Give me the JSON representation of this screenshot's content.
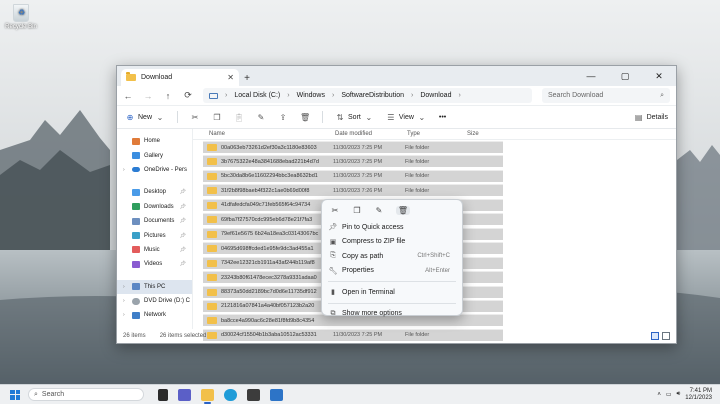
{
  "desktop": {
    "recycle_bin_label": "Recycle Bin"
  },
  "window": {
    "tab_title": "Download",
    "close_tab_glyph": "✕",
    "new_tab_glyph": "+",
    "controls": {
      "minimize": "—",
      "maximize": "▢",
      "close": "✕"
    },
    "breadcrumbs": [
      "Local Disk (C:)",
      "Windows",
      "SoftwareDistribution",
      "Download"
    ],
    "search_placeholder": "Search Download"
  },
  "toolbar": {
    "new_label": "New",
    "sort_label": "Sort",
    "view_label": "View",
    "more_label": "•••",
    "details_label": "Details"
  },
  "sidebar": {
    "items": [
      {
        "label": "Home",
        "icon": "home-icon"
      },
      {
        "label": "Gallery",
        "icon": "gallery-icon"
      },
      {
        "label": "OneDrive - Pers",
        "icon": "onedrive-icon"
      },
      {
        "label": "Desktop",
        "icon": "desktop-icon",
        "pinned": true
      },
      {
        "label": "Downloads",
        "icon": "downloads-icon",
        "pinned": true
      },
      {
        "label": "Documents",
        "icon": "documents-icon",
        "pinned": true
      },
      {
        "label": "Pictures",
        "icon": "pictures-icon",
        "pinned": true
      },
      {
        "label": "Music",
        "icon": "music-icon",
        "pinned": true
      },
      {
        "label": "Videos",
        "icon": "videos-icon",
        "pinned": true
      },
      {
        "label": "This PC",
        "icon": "this-pc-icon",
        "selected": true
      },
      {
        "label": "DVD Drive (D:) C",
        "icon": "dvd-icon"
      },
      {
        "label": "Network",
        "icon": "network-icon"
      }
    ]
  },
  "columns": {
    "name": "Name",
    "date": "Date modified",
    "type": "Type",
    "size": "Size"
  },
  "files": [
    {
      "name": "00a063eb73261d2ef30a3c1180e83603",
      "date": "11/30/2023 7:25 PM",
      "type": "File folder"
    },
    {
      "name": "3b7675322e48a3841688ebad221b4d7d",
      "date": "11/30/2023 7:25 PM",
      "type": "File folder"
    },
    {
      "name": "5bc30da8b6e11602294bbc3ea8632bd1",
      "date": "11/30/2023 7:25 PM",
      "type": "File folder"
    },
    {
      "name": "31f2b8f98baeb4f322c1ae0b69d00f8",
      "date": "11/30/2023 7:26 PM",
      "type": "File folder"
    },
    {
      "name": "41dfafedcfa049c71feb565f64c94734",
      "date": "",
      "type": ""
    },
    {
      "name": "69fba7f27570cdc995eb6d78e21f7fa3",
      "date": "",
      "type": ""
    },
    {
      "name": "79ef61e5675 6b24a18ea3c03143067bc",
      "date": "",
      "type": ""
    },
    {
      "name": "04695d698ffcded1e95fe9dc3ad455a1",
      "date": "",
      "type": ""
    },
    {
      "name": "7342ee12321cb1911a43af244b119af8",
      "date": "",
      "type": ""
    },
    {
      "name": "23243b80f61478ecec3278a9331adaa0",
      "date": "",
      "type": ""
    },
    {
      "name": "88373a50dd2189bc7d0d6e11735df912",
      "date": "",
      "type": ""
    },
    {
      "name": "2121816a07841a4a40bf057123b2a20",
      "date": "",
      "type": ""
    },
    {
      "name": "ba8cce4a990ac6c28e81f8fd9b8c4354",
      "date": "",
      "type": ""
    },
    {
      "name": "d30024cf15504b1b3aba10512ac53331",
      "date": "11/30/2023 7:25 PM",
      "type": "File folder"
    }
  ],
  "status": {
    "count": "26 items",
    "selected": "26 items selected"
  },
  "context_menu": {
    "icons": [
      "cut-icon",
      "copy-icon",
      "rename-icon",
      "delete-icon"
    ],
    "items": [
      {
        "label": "Pin to Quick access",
        "shortcut": "",
        "icon": "pin-icon"
      },
      {
        "label": "Compress to ZIP file",
        "shortcut": "",
        "icon": "zip-icon"
      },
      {
        "label": "Copy as path",
        "shortcut": "Ctrl+Shift+C",
        "icon": "copy-path-icon"
      },
      {
        "label": "Properties",
        "shortcut": "Alt+Enter",
        "icon": "properties-icon"
      },
      {
        "label": "Open in Terminal",
        "shortcut": "",
        "icon": "terminal-icon"
      },
      {
        "label": "Show more options",
        "shortcut": "",
        "icon": "more-options-icon"
      }
    ]
  },
  "taskbar": {
    "search_label": "Search",
    "time": "7:41 PM",
    "date": "12/1/2023",
    "accent": "#2b63c6"
  }
}
